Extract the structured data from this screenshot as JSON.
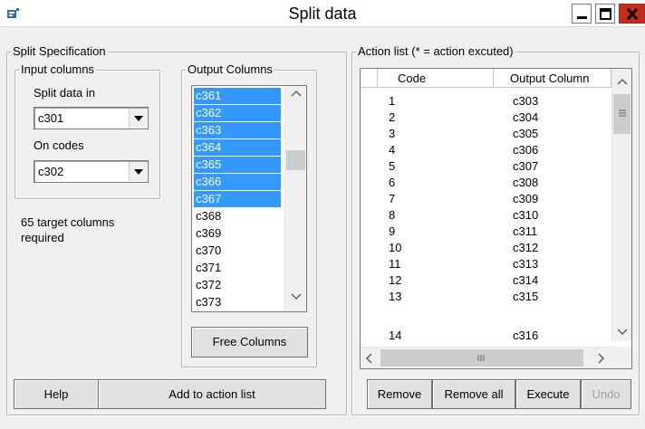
{
  "window": {
    "title": "Split data",
    "icon": "app-icon"
  },
  "split_spec": {
    "legend": "Split Specification",
    "input_columns": {
      "legend": "Input columns",
      "split_label": "Split data in",
      "split_value": "c301",
      "codes_label": "On codes",
      "codes_value": "c302"
    },
    "target_note_line1": "65 target columns",
    "target_note_line2": "required",
    "output_columns": {
      "legend": "Output Columns",
      "items": [
        "c361",
        "c362",
        "c363",
        "c364",
        "c365",
        "c366",
        "c367",
        "c368",
        "c369",
        "c370",
        "c371",
        "c372",
        "c373"
      ],
      "selected_count": 7,
      "free_button": "Free Columns"
    },
    "help_button": "Help",
    "add_button": "Add to action list"
  },
  "action_list": {
    "legend": "Action list (* = action excuted)",
    "columns": [
      "Code",
      "Output Column"
    ],
    "rows": [
      [
        "1",
        "c303"
      ],
      [
        "2",
        "c304"
      ],
      [
        "3",
        "c305"
      ],
      [
        "4",
        "c306"
      ],
      [
        "5",
        "c307"
      ],
      [
        "6",
        "c308"
      ],
      [
        "7",
        "c309"
      ],
      [
        "8",
        "c310"
      ],
      [
        "9",
        "c311"
      ],
      [
        "10",
        "c312"
      ],
      [
        "11",
        "c313"
      ],
      [
        "12",
        "c314"
      ],
      [
        "13",
        "c315"
      ],
      [
        "14",
        "c316"
      ]
    ],
    "buttons": {
      "remove": "Remove",
      "remove_all": "Remove all",
      "execute": "Execute",
      "undo": "Undo"
    }
  },
  "colors": {
    "selection": "#3399ff",
    "close_button": "#c42b1c"
  }
}
